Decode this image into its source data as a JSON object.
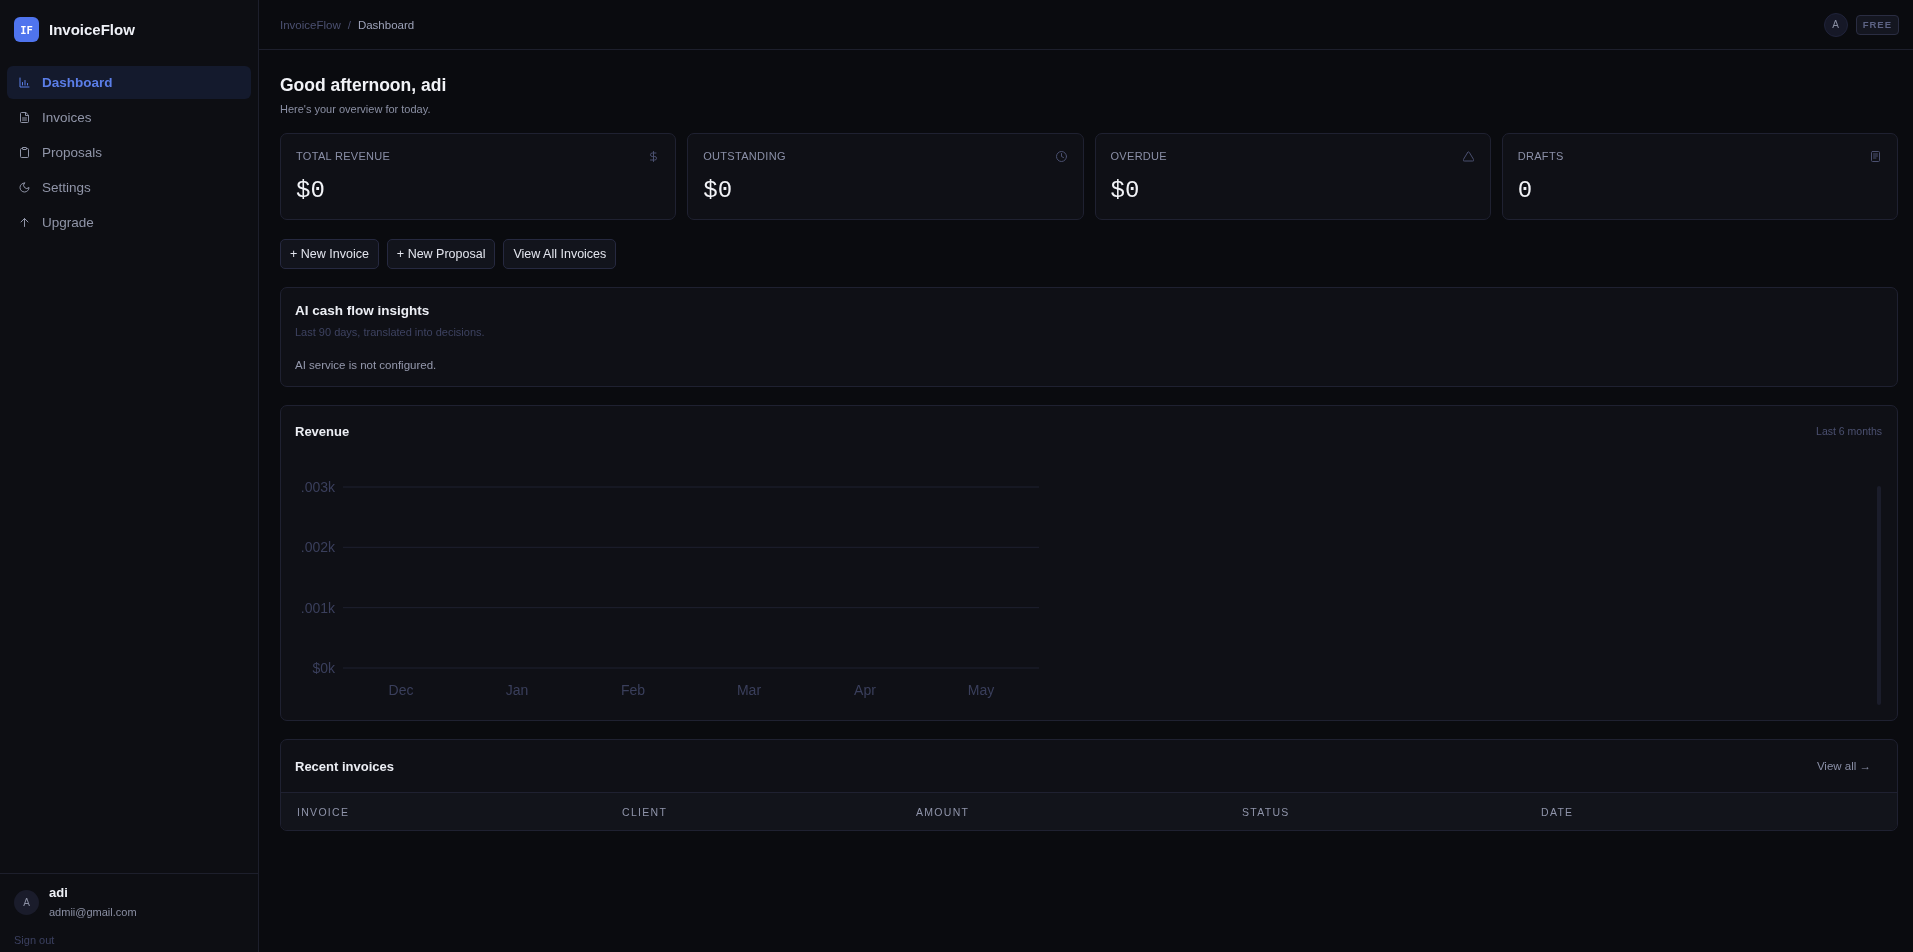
{
  "sidebar": {
    "logo": {
      "mark": "IF",
      "name": "InvoiceFlow"
    },
    "items": [
      {
        "label": "Dashboard",
        "selected": true
      },
      {
        "label": "Invoices",
        "selected": false
      },
      {
        "label": "Proposals",
        "selected": false
      },
      {
        "label": "Settings",
        "selected": false
      },
      {
        "label": "Upgrade",
        "selected": false
      }
    ],
    "user": {
      "avatar": "A",
      "name": "adi",
      "email": "admii@gmail.com"
    },
    "sign_out": "Sign out"
  },
  "header": {
    "breadcrumb": [
      "InvoiceFlow",
      "Dashboard"
    ],
    "separator": "/",
    "avatar": "A",
    "plan": "FREE"
  },
  "greeting": {
    "title": "Good afternoon, adi",
    "subtitle": "Here's your overview for today."
  },
  "stats": [
    {
      "label": "TOTAL REVENUE",
      "value": "$0"
    },
    {
      "label": "OUTSTANDING",
      "value": "$0"
    },
    {
      "label": "OVERDUE",
      "value": "$0"
    },
    {
      "label": "DRAFTS",
      "value": "0"
    }
  ],
  "actions": [
    "+ New Invoice",
    "+ New Proposal",
    "View All Invoices"
  ],
  "insights": {
    "title": "AI cash flow insights",
    "subtitle": "Last 90 days, translated into decisions.",
    "message": "AI service is not configured."
  },
  "revenue": {
    "title": "Revenue",
    "range": "Last 6 months",
    "chart_data": {
      "type": "bar",
      "categories": [
        "Dec",
        "Jan",
        "Feb",
        "Mar",
        "Apr",
        "May"
      ],
      "values": [
        0,
        0,
        0,
        0,
        0,
        0
      ],
      "ylim": [
        0,
        3
      ],
      "yticks": [
        {
          "value": 0,
          "label": "$0k"
        },
        {
          "value": 1,
          "label": ".001k"
        },
        {
          "value": 2,
          "label": ".002k"
        },
        {
          "value": 3,
          "label": ".003k"
        }
      ]
    }
  },
  "recent_invoices": {
    "title": "Recent invoices",
    "link": "View all →",
    "columns": [
      "INVOICE",
      "CLIENT",
      "AMOUNT",
      "STATUS",
      "DATE"
    ]
  }
}
